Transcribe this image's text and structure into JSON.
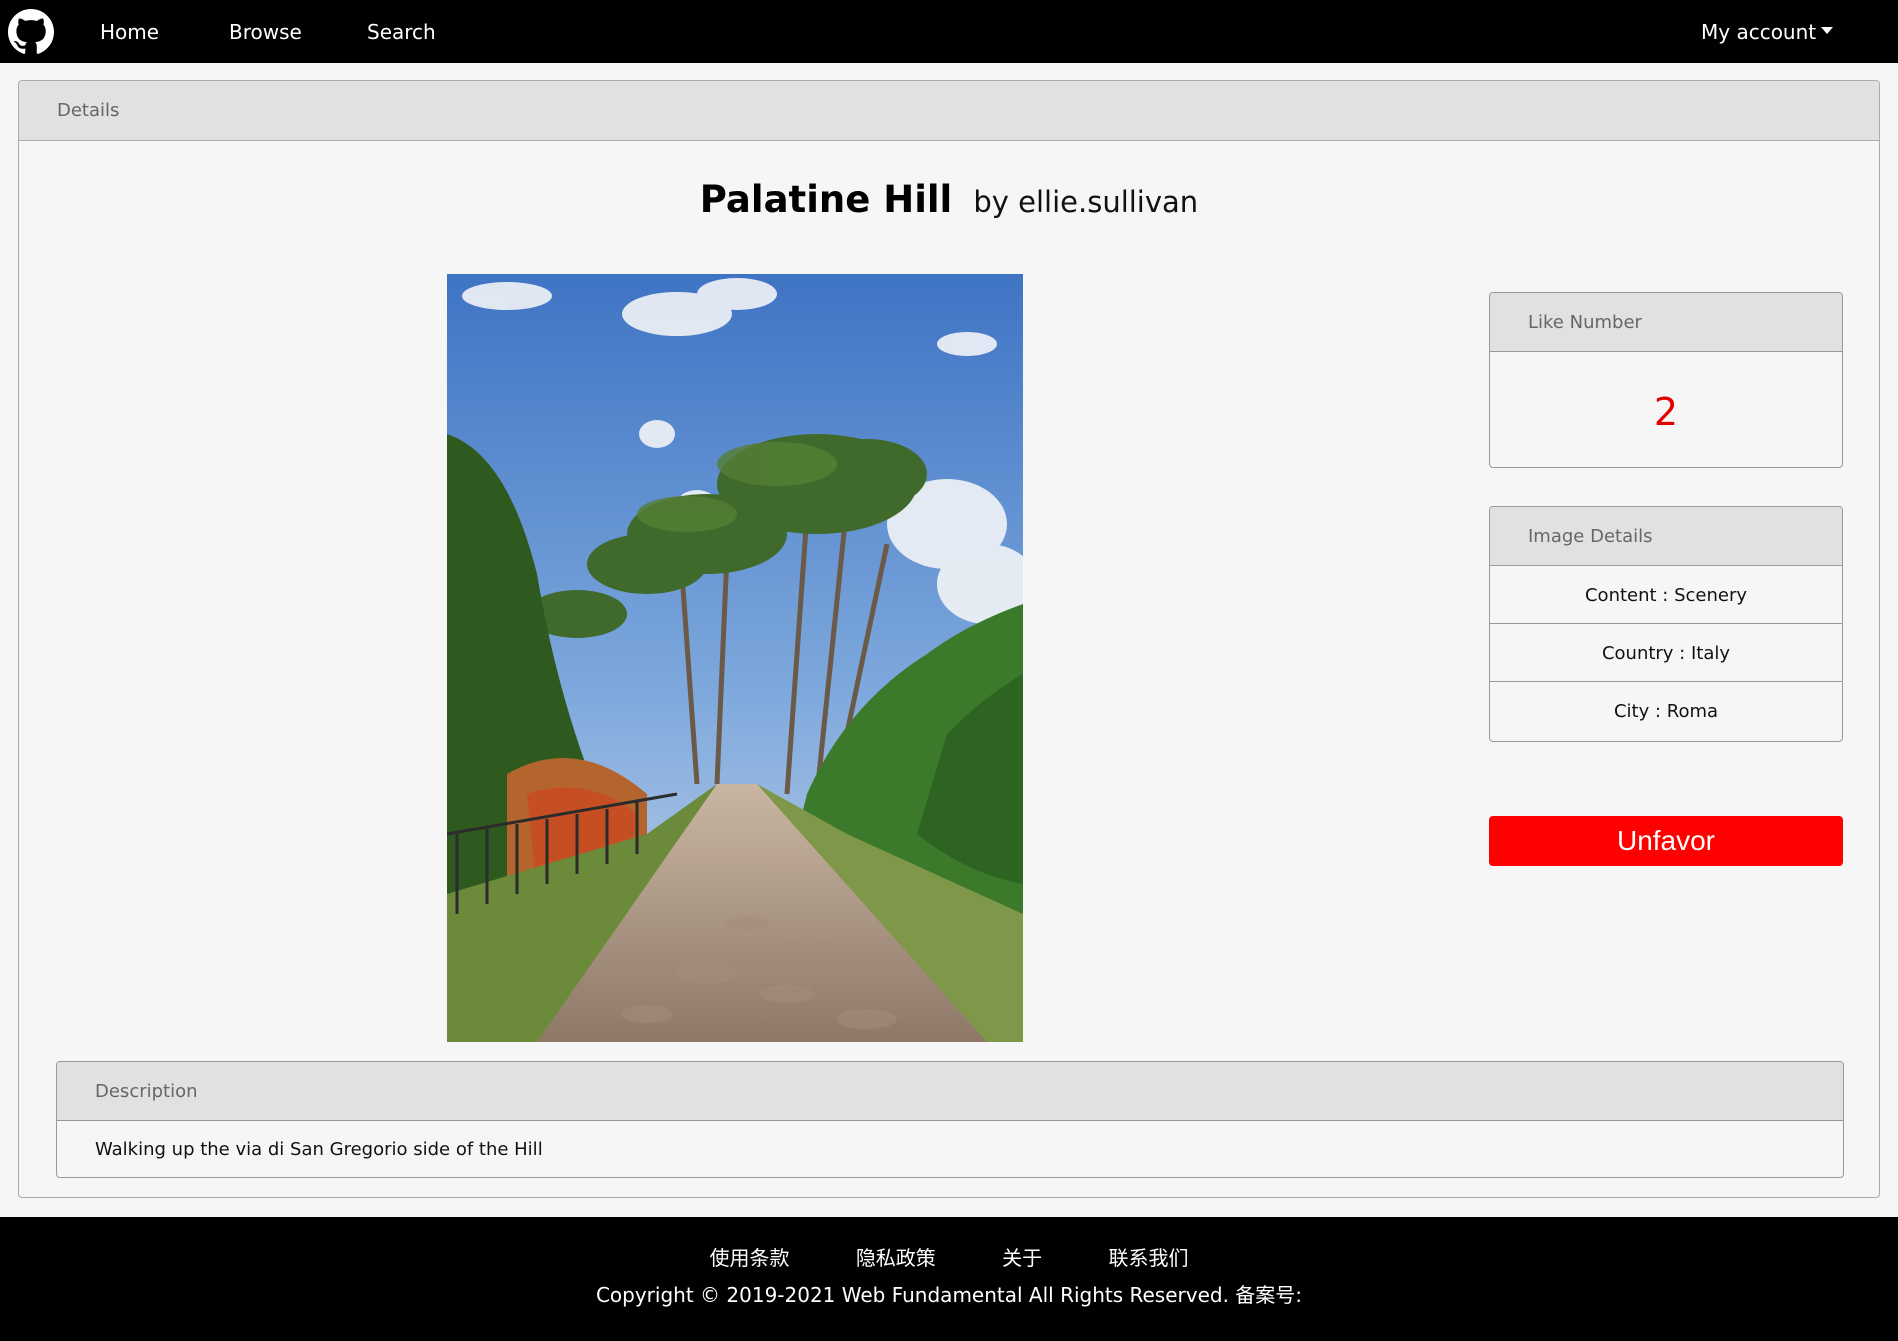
{
  "nav": {
    "home": "Home",
    "browse": "Browse",
    "search": "Search",
    "account": "My account"
  },
  "card": {
    "header": "Details"
  },
  "image": {
    "title": "Palatine Hill",
    "author": "by ellie.sullivan"
  },
  "like_panel": {
    "header": "Like Number",
    "value": "2"
  },
  "details_panel": {
    "header": "Image Details",
    "rows": [
      "Content : Scenery",
      "Country : Italy",
      "City : Roma"
    ]
  },
  "actions": {
    "unfavor": "Unfavor"
  },
  "description": {
    "header": "Description",
    "text": "Walking up the via di San Gregorio side of the Hill"
  },
  "footer": {
    "links": [
      "使用条款",
      "隐私政策",
      "关于",
      "联系我们"
    ],
    "copyright": "Copyright © 2019-2021 Web Fundamental All Rights Reserved. 备案号:"
  },
  "colors": {
    "unfavor_bg": "#ff0000",
    "like_number": "#e00000",
    "navbar_bg": "#000000",
    "panel_header_bg": "#e2e1e0"
  }
}
